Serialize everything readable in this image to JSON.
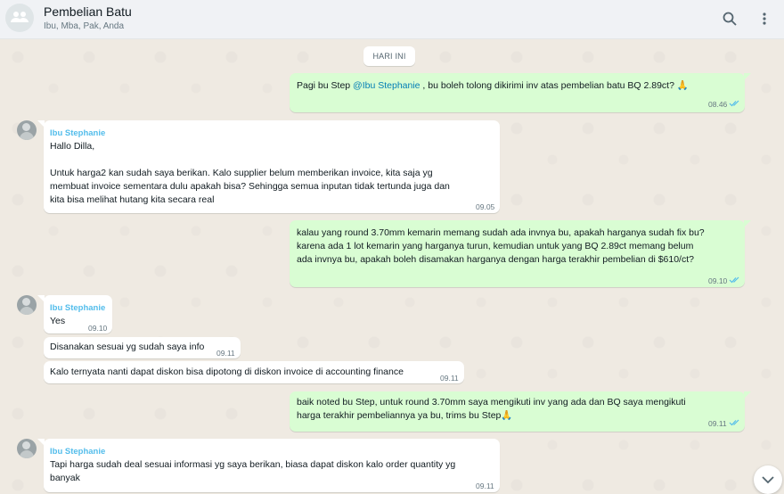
{
  "header": {
    "title": "Pembelian Batu",
    "subtitle": "Ibu, Mba, Pak, Anda",
    "group_icon": "group-avatar-icon",
    "search_icon": "search-icon",
    "menu_icon": "more-vertical-icon"
  },
  "date_separator": "HARI INI",
  "messages": [
    {
      "dir": "out",
      "text_prefix": "Pagi bu Step ",
      "mention": "@Ibu Stephanie",
      "text_suffix": " , bu boleh tolong dikirimi inv atas pembelian batu BQ 2.89ct? 🙏",
      "time": "08.46"
    },
    {
      "dir": "in",
      "sender": "Ibu Stephanie",
      "text": "Hallo Dilla,\n\nUntuk harga2 kan sudah saya berikan. Kalo supplier belum memberikan invoice, kita saja yg\nmembuat invoice sementara dulu apakah bisa? Sehingga semua inputan tidak tertunda juga dan\nkita bisa melihat hutang kita secara real",
      "time": "09.05"
    },
    {
      "dir": "out",
      "text": "kalau yang round 3.70mm kemarin memang sudah ada invnya bu, apakah harganya sudah fix bu?\nkarena ada 1 lot kemarin yang harganya turun, kemudian untuk yang BQ 2.89ct memang belum\nada invnya bu, apakah boleh disamakan harganya dengan harga terakhir pembelian di $610/ct?",
      "time": "09.10"
    },
    {
      "dir": "in",
      "sender": "Ibu Stephanie",
      "text": "Yes",
      "time": "09.10"
    },
    {
      "dir": "in",
      "text": "Disanakan sesuai yg sudah saya info",
      "time": "09.11"
    },
    {
      "dir": "in",
      "text": "Kalo ternyata nanti dapat diskon bisa dipotong di diskon invoice di accounting finance",
      "time": "09.11"
    },
    {
      "dir": "out",
      "text": "baik noted bu Step, untuk round 3.70mm saya mengikuti inv yang ada dan BQ saya mengikuti\nharga terakhir pembeliannya ya bu, trims bu Step🙏",
      "time": "09.11"
    },
    {
      "dir": "in",
      "sender": "Ibu Stephanie",
      "text": "Tapi harga sudah deal sesuai informasi yg saya berikan, biasa dapat diskon kalo order quantity yg\nbanyak",
      "time": "09.11"
    }
  ],
  "scroll_icon": "chevron-down-icon",
  "colors": {
    "outgoing": "#d9fdd3",
    "incoming": "#ffffff",
    "sender": "#53bdeb",
    "mention": "#027eb5",
    "read_ticks": "#53bdeb"
  }
}
